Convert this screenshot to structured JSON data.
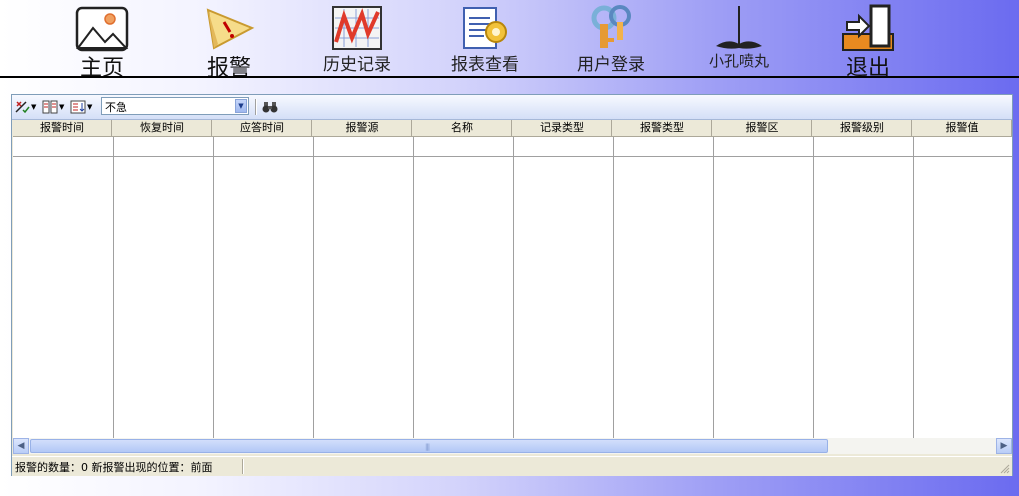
{
  "nav": {
    "items": [
      {
        "label": "主页",
        "icon": "home-picture-icon"
      },
      {
        "label": "报警",
        "icon": "alarm-warning-icon"
      },
      {
        "label": "历史记录",
        "icon": "history-chart-icon"
      },
      {
        "label": "报表查看",
        "icon": "report-view-icon"
      },
      {
        "label": "用户登录",
        "icon": "user-login-keys-icon"
      },
      {
        "label": "小孔喷丸",
        "icon": "shot-peening-icon"
      },
      {
        "label": "退出",
        "icon": "exit-door-icon"
      }
    ]
  },
  "toolbar": {
    "filter_select": {
      "value": "不急"
    },
    "buttons": [
      "acknowledge-icon",
      "columns-icon",
      "sort-icon",
      "binoculars-find-icon"
    ]
  },
  "table": {
    "columns": [
      "报警时间",
      "恢复时间",
      "应答时间",
      "报警源",
      "名称",
      "记录类型",
      "报警类型",
      "报警区",
      "报警级别",
      "报警值"
    ],
    "rows": []
  },
  "status": {
    "text": "报警的数量：0  新报警出现的位置：前面"
  },
  "colors": {
    "accent": "#6b6bf0",
    "window": "#ece9d8",
    "border": "#7f9db9"
  }
}
